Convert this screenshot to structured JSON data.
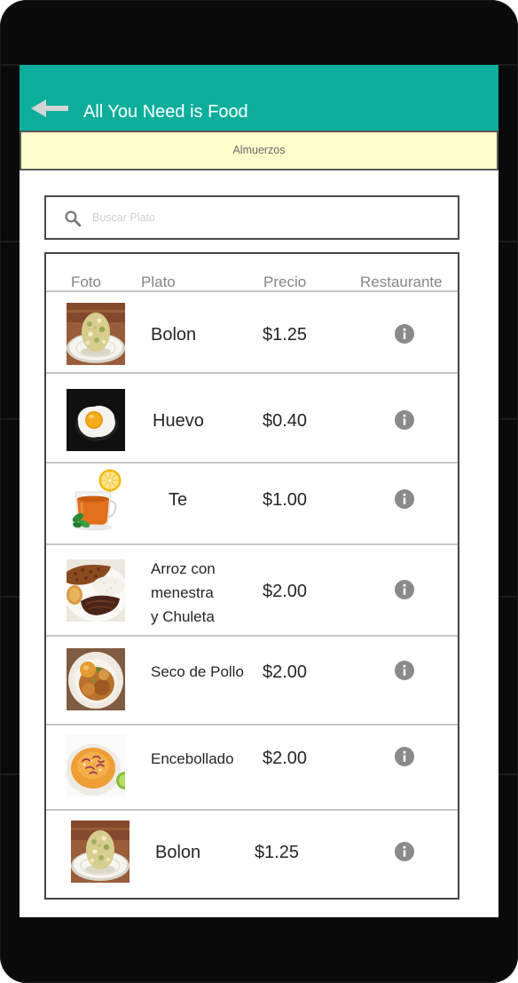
{
  "app_bar": {
    "title": "All You Need is Food",
    "back_icon": "arrow-left-icon"
  },
  "category_bar": {
    "label": "Almuerzos"
  },
  "search": {
    "icon": "search-icon",
    "placeholder": "Buscar Plato",
    "value": ""
  },
  "table": {
    "headers": {
      "photo": "Foto",
      "dish": "Plato",
      "price": "Precio",
      "restaurant": "Restaurante"
    },
    "restaurant_icon": "info-icon",
    "rows": [
      {
        "dish": [
          "Bolon"
        ],
        "price": "$1.25"
      },
      {
        "dish": [
          "Huevo"
        ],
        "price": "$0.40"
      },
      {
        "dish": [
          "Te"
        ],
        "price": "$1.00"
      },
      {
        "dish": [
          "Arroz con",
          "menestra",
          "y Chuleta"
        ],
        "price": "$2.00"
      },
      {
        "dish": [
          "Seco de Pollo"
        ],
        "price": "$2.00"
      },
      {
        "dish": [
          "Encebollado"
        ],
        "price": "$2.00"
      },
      {
        "dish": [
          "Bolon"
        ],
        "price": "$1.25"
      }
    ]
  },
  "theme": {
    "app_bar": "#0bae9b",
    "category_bar": "#ffffcc",
    "info_icon": "#8a8a8a"
  }
}
